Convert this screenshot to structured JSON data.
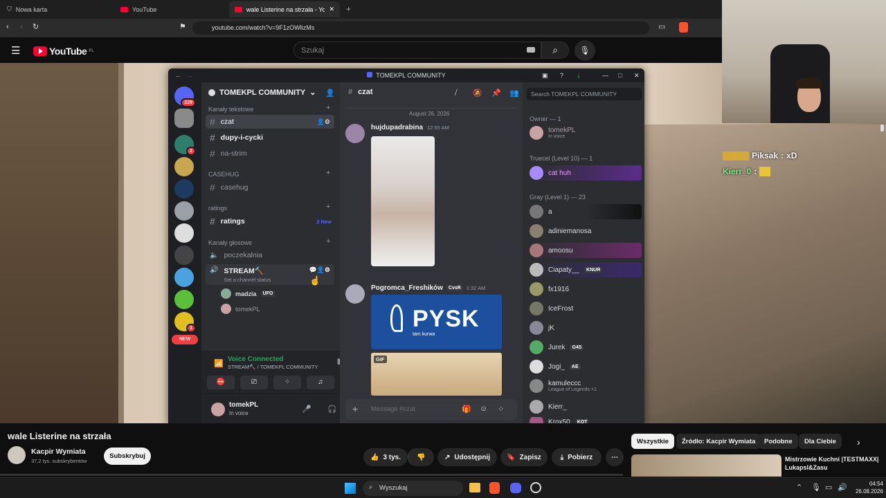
{
  "browser": {
    "tabs": [
      {
        "label": "Nowa karta"
      },
      {
        "label": "YouTube"
      },
      {
        "label": "wale Listerine na strzała - YouTube"
      }
    ],
    "url": "youtube.com/watch?v=9F1zOWlizMs"
  },
  "youtube": {
    "logo": "YouTube",
    "region": "PL",
    "search_placeholder": "Szukaj",
    "video_title": "wale Listerine na strzała",
    "channel_name": "Kacpir Wymiata",
    "subscribers": "37,2 tys. subskrybentów",
    "subscribe_label": "Subskrybuj",
    "like_count": "3 tys.",
    "share_label": "Udostępnij",
    "save_label": "Zapisz",
    "download_label": "Pobierz",
    "chips": [
      "Wszystkie",
      "Źródło: Kacpir Wymiata",
      "Podobne",
      "Dla Ciebie"
    ],
    "rec_title": "Mistrzowie Kuchni |TESTMAXX| Lukapsl&Zasu"
  },
  "stream_chat": [
    {
      "user": "Piksak",
      "text": "xD"
    },
    {
      "user": "Kierr_0",
      "text": ""
    }
  ],
  "discord": {
    "window_title": "TOMEKPL COMMUNITY",
    "server_name": "TOMEKPL COMMUNITY",
    "guild_badges": [
      "229",
      "2",
      "1"
    ],
    "new_label": "NEW",
    "categories": {
      "text": "Kanały tekstowe",
      "casehug": "CASEHUG",
      "ratings": "ratings",
      "voice": "Kanały głosowe"
    },
    "channels": {
      "czat": "czat",
      "dupy": "dupy-i-cycki",
      "na_strim": "na-strim",
      "casehug": "casehug",
      "ratings": "ratings",
      "ratings_new": "2 New",
      "poczekalnia": "poczekalnia",
      "stream": "STREAM🔨",
      "stream_status": "Set a channel status"
    },
    "voice_users": [
      {
        "name": "madzia",
        "tag": "UFO"
      },
      {
        "name": "tomekPL",
        "tag": ""
      }
    ],
    "voice": {
      "status": "Voice Connected",
      "where": "STREAM🔨 / TOMEKPL COMMUNITY"
    },
    "user": {
      "name": "tomekPL",
      "status": "In voice"
    },
    "main": {
      "channel": "czat",
      "search_placeholder": "Search TOMEKPL COMMUNITY",
      "date": "August 26, 2026",
      "message_placeholder": "Message #czat",
      "gif": "GIF",
      "pysk_text": "PYSK",
      "pysk_sub": "tam kurwa"
    },
    "messages": [
      {
        "author": "hujdupadrabina",
        "time": "12:55 AM"
      },
      {
        "author": "Pogromca_Freshików",
        "tag": "CvsR",
        "time": "1:32 AM"
      }
    ],
    "member_groups": {
      "owner": "Owner — 1",
      "truecel": "Truecel (Level 10) — 1",
      "gray": "Gray (Level 1) — 23"
    },
    "members": [
      {
        "name": "tomekPL",
        "sub": "In voice",
        "color": "#c9a3a3"
      },
      {
        "name": "cat huh",
        "sub": "",
        "color": "#a78bfa"
      },
      {
        "name": "a",
        "sub": "",
        "color": "#777"
      },
      {
        "name": "adiniemanosa",
        "sub": "",
        "color": "#8a7f70"
      },
      {
        "name": "amoosu",
        "sub": "",
        "color": "#a77"
      },
      {
        "name": "Ciapaty__",
        "sub": "",
        "tag": "KNUR",
        "color": "#bbb"
      },
      {
        "name": "fx1916",
        "sub": "",
        "color": "#996"
      },
      {
        "name": "IceFrost",
        "sub": "",
        "color": "#776"
      },
      {
        "name": "jK",
        "sub": "",
        "color": "#889"
      },
      {
        "name": "Jurek",
        "sub": "",
        "tag": "G4S",
        "color": "#5a6"
      },
      {
        "name": "Jogi_",
        "sub": "",
        "tag": "AE",
        "color": "#ddd"
      },
      {
        "name": "kamuleccc",
        "sub": "League of Legends +1",
        "color": "#888"
      },
      {
        "name": "Kierr_",
        "sub": "",
        "color": "#aaa"
      },
      {
        "name": "Krox50",
        "sub": "",
        "tag": "KOT",
        "color": "#a58"
      }
    ]
  },
  "taskbar": {
    "search": "Wyszukaj",
    "time": "04:54",
    "date": "26.08.2026"
  }
}
